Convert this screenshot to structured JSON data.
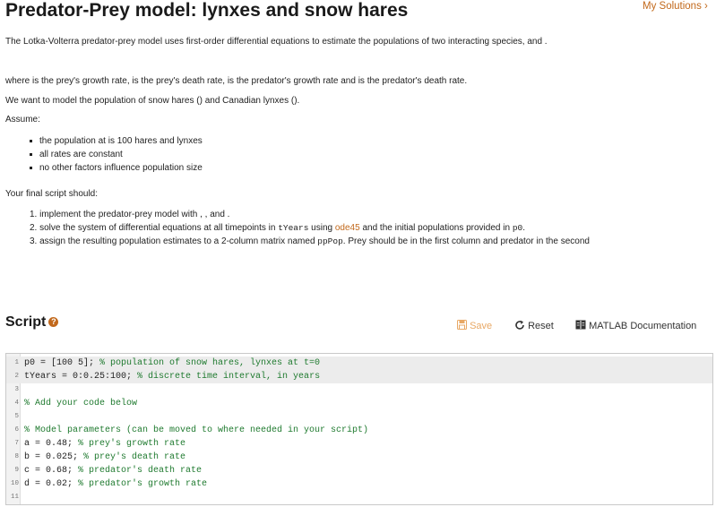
{
  "header": {
    "title": "Predator-Prey model: lynxes and snow hares",
    "my_solutions": "My Solutions ›"
  },
  "description": {
    "intro": "The Lotka-Volterra predator-prey model uses first-order differential equations to estimate the populations of two interacting species,  and .",
    "where": "where  is the prey's growth rate,  is the prey's death rate,  is the predator's growth rate and  is the predator's death rate.",
    "want": "We want to model the population of snow hares () and Canadian lynxes ().",
    "assume_label": "Assume:",
    "assume_items": [
      "the population at  is 100 hares and  lynxes",
      "all rates are constant",
      "no other factors influence population size"
    ],
    "final_label": "Your final script should:",
    "steps": {
      "s1": "1. implement the predator-prey model with , ,  and .",
      "s2_pre": "2. solve the system of differential equations at all timepoints in ",
      "s2_code1": "tYears",
      "s2_mid": " using ",
      "s2_link": "ode45",
      "s2_post": " and the initial populations provided in ",
      "s2_code2": "p0",
      "s2_end": ".",
      "s3_pre": "3. assign the resulting population estimates to a 2-column matrix named ",
      "s3_code": "ppPop",
      "s3_post": ". Prey should be in the first column and predator in the second"
    }
  },
  "script": {
    "heading": "Script",
    "help_glyph": "?",
    "save_label": "Save",
    "reset_label": "Reset",
    "doc_label": "MATLAB Documentation",
    "lines": [
      {
        "n": "1",
        "code": "p0 = [100 5]; ",
        "comment": "% population of snow hares, lynxes at t=0"
      },
      {
        "n": "2",
        "code": "tYears = 0:0.25:100; ",
        "comment": "% discrete time interval, in years"
      },
      {
        "n": "3",
        "code": "",
        "comment": ""
      },
      {
        "n": "4",
        "code": "",
        "comment": "% Add your code below"
      },
      {
        "n": "5",
        "code": "",
        "comment": ""
      },
      {
        "n": "6",
        "code": "",
        "comment": "% Model parameters (can be moved to where needed in your script)"
      },
      {
        "n": "7",
        "code": "a = 0.48;  ",
        "comment": "% prey's growth rate"
      },
      {
        "n": "8",
        "code": "b = 0.025; ",
        "comment": "% prey's death rate"
      },
      {
        "n": "9",
        "code": "c = 0.68;  ",
        "comment": "% predator's death rate"
      },
      {
        "n": "10",
        "code": "d = 0.02;  ",
        "comment": "% predator's growth rate"
      },
      {
        "n": "11",
        "code": "",
        "comment": ""
      }
    ]
  },
  "colors": {
    "accent": "#c2691c",
    "comment": "#1f7a2f"
  },
  "icons": {
    "save": "save-icon",
    "reset": "reset-icon",
    "doc": "book-icon",
    "help": "help-icon",
    "chevron": "chevron-right-icon"
  }
}
